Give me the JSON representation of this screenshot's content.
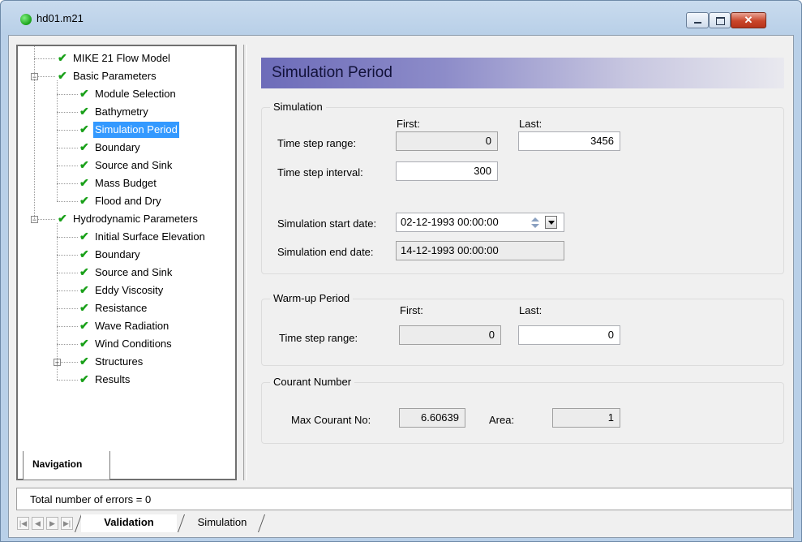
{
  "window": {
    "title": "hd01.m21",
    "minimize_glyph": "",
    "maximize_glyph": "",
    "close_glyph": "✕"
  },
  "nav": {
    "items": [
      {
        "label": "MIKE 21 Flow Model",
        "level": 0,
        "checked": true
      },
      {
        "label": "Basic Parameters",
        "level": 0,
        "checked": true,
        "expander": "−"
      },
      {
        "label": "Module Selection",
        "level": 1,
        "checked": true
      },
      {
        "label": "Bathymetry",
        "level": 1,
        "checked": true
      },
      {
        "label": "Simulation Period",
        "level": 1,
        "checked": true,
        "selected": true
      },
      {
        "label": "Boundary",
        "level": 1,
        "checked": true
      },
      {
        "label": "Source and Sink",
        "level": 1,
        "checked": true
      },
      {
        "label": "Mass Budget",
        "level": 1,
        "checked": true
      },
      {
        "label": "Flood and Dry",
        "level": 1,
        "checked": true
      },
      {
        "label": "Hydrodynamic Parameters",
        "level": 0,
        "checked": true,
        "expander": "−"
      },
      {
        "label": "Initial Surface Elevation",
        "level": 1,
        "checked": true
      },
      {
        "label": "Boundary",
        "level": 1,
        "checked": true
      },
      {
        "label": "Source and Sink",
        "level": 1,
        "checked": true
      },
      {
        "label": "Eddy Viscosity",
        "level": 1,
        "checked": true
      },
      {
        "label": "Resistance",
        "level": 1,
        "checked": true
      },
      {
        "label": "Wave Radiation",
        "level": 1,
        "checked": true
      },
      {
        "label": "Wind Conditions",
        "level": 1,
        "checked": true
      },
      {
        "label": "Structures",
        "level": 1,
        "checked": true,
        "expander": "+"
      },
      {
        "label": "Results",
        "level": 1,
        "checked": true
      }
    ],
    "tab_label": "Navigation",
    "check_glyph": "✔"
  },
  "page": {
    "title": "Simulation Period",
    "simulation": {
      "group_title": "Simulation",
      "first_header": "First:",
      "last_header": "Last:",
      "time_step_range_label": "Time step range:",
      "first_value": "0",
      "last_value": "3456",
      "time_step_interval_label": "Time step interval:",
      "interval_value": "300",
      "start_date_label": "Simulation start date:",
      "start_date_value": "02-12-1993 00:00:00",
      "end_date_label": "Simulation end date:",
      "end_date_value": "14-12-1993 00:00:00"
    },
    "warmup": {
      "group_title": "Warm-up Period",
      "first_header": "First:",
      "last_header": "Last:",
      "time_step_range_label": "Time step range:",
      "first_value": "0",
      "last_value": "0"
    },
    "courant": {
      "group_title": "Courant Number",
      "max_label": "Max Courant No:",
      "max_value": "6.60639",
      "area_label": "Area:",
      "area_value": "1"
    }
  },
  "status": {
    "message": "Total number of errors = 0",
    "tabs": [
      {
        "label": "Validation",
        "active": true
      },
      {
        "label": "Simulation",
        "active": false
      }
    ],
    "nav_buttons": [
      "first",
      "prev",
      "next",
      "last"
    ]
  }
}
